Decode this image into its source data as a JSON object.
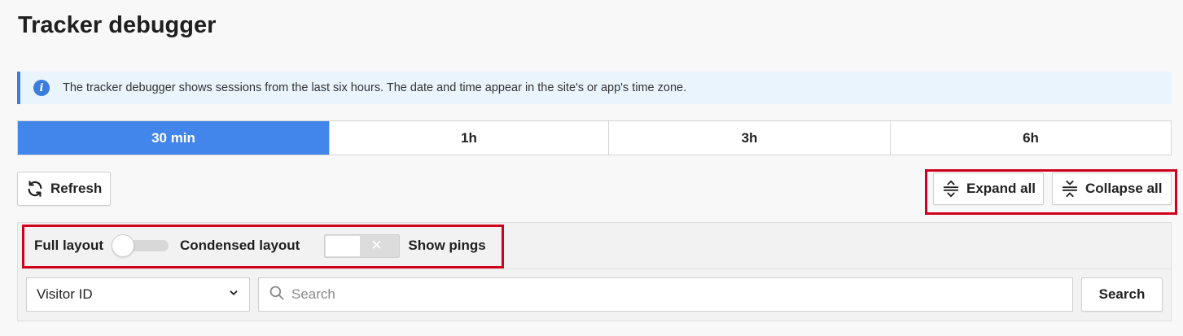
{
  "page": {
    "title": "Tracker debugger"
  },
  "info": {
    "icon": "info-icon",
    "text": "The tracker debugger shows sessions from the last six hours. The date and time appear in the site's or app's time zone."
  },
  "time_tabs": [
    {
      "label": "30 min",
      "active": true
    },
    {
      "label": "1h",
      "active": false
    },
    {
      "label": "3h",
      "active": false
    },
    {
      "label": "6h",
      "active": false
    }
  ],
  "toolbar": {
    "refresh_label": "Refresh",
    "expand_all_label": "Expand all",
    "collapse_all_label": "Collapse all"
  },
  "layout": {
    "full_label": "Full layout",
    "condensed_label": "Condensed layout",
    "show_pings_label": "Show pings",
    "show_pings_x": "✕"
  },
  "filter": {
    "selected_field": "Visitor ID",
    "search_placeholder": "Search",
    "search_button": "Search"
  },
  "colors": {
    "accent": "#4285eb",
    "highlight": "#d0021b",
    "info_background": "#eaf4fd"
  }
}
